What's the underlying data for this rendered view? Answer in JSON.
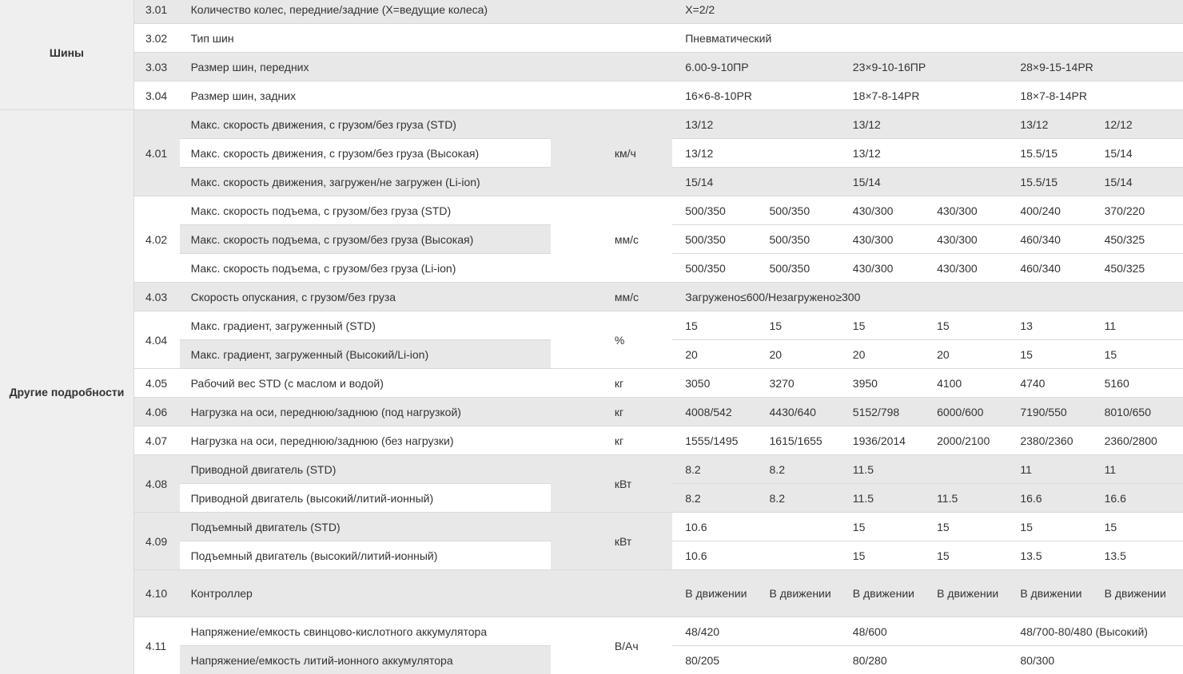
{
  "sections": [
    {
      "label": "Шины"
    },
    {
      "label": "Другие подробности"
    }
  ],
  "rows": [
    {
      "code": "3.01",
      "desc": "Количество колес, передние/задние (X=ведущие колеса)",
      "unit": "",
      "values": [
        "X=2/2"
      ]
    },
    {
      "code": "3.02",
      "desc": "Тип шин",
      "unit": "",
      "values": [
        "Пневматический"
      ]
    },
    {
      "code": "3.03",
      "desc": "Размер шин, передних",
      "unit": "",
      "values": [
        "6.00-9-10ПР",
        "23×9-10-16ПР",
        "28×9-15-14PR"
      ]
    },
    {
      "code": "3.04",
      "desc": "Размер шин, задних",
      "unit": "",
      "values": [
        "16×6-8-10PR",
        "18×7-8-14PR",
        "18×7-8-14PR"
      ]
    },
    {
      "code": "4.01",
      "desc": "Макс. скорость движения, с грузом/без груза (STD)",
      "unit": "км/ч",
      "values": [
        "13/12",
        "13/12",
        "13/12",
        "12/12"
      ]
    },
    {
      "code": "",
      "desc": "Макс. скорость движения, с грузом/без груза (Высокая)",
      "unit": "",
      "values": [
        "13/12",
        "13/12",
        "15.5/15",
        "15/14"
      ]
    },
    {
      "code": "",
      "desc": "Макс. скорость движения, загружен/не загружен (Li-ion)",
      "unit": "",
      "values": [
        "15/14",
        "15/14",
        "15.5/15",
        "15/14"
      ]
    },
    {
      "code": "4.02",
      "desc": "Макс. скорость подъема, с грузом/без груза (STD)",
      "unit": "мм/с",
      "values": [
        "500/350",
        "500/350",
        "430/300",
        "430/300",
        "400/240",
        "370/220"
      ]
    },
    {
      "code": "",
      "desc": "Макс. скорость подъема, с грузом/без груза (Высокая)",
      "unit": "",
      "values": [
        "500/350",
        "500/350",
        "430/300",
        "430/300",
        "460/340",
        "450/325"
      ]
    },
    {
      "code": "",
      "desc": "Макс. скорость подъема, с грузом/без груза (Li-ion)",
      "unit": "",
      "values": [
        "500/350",
        "500/350",
        "430/300",
        "430/300",
        "460/340",
        "450/325"
      ]
    },
    {
      "code": "4.03",
      "desc": "Скорость опускания, с грузом/без груза",
      "unit": "мм/с",
      "values": [
        "Загружено≤600/Незагружено≥300"
      ]
    },
    {
      "code": "4.04",
      "desc": "Макс. градиент, загруженный (STD)",
      "unit": "%",
      "values": [
        "15",
        "15",
        "15",
        "15",
        "13",
        "11"
      ]
    },
    {
      "code": "",
      "desc": "Макс. градиент, загруженный (Высокий/Li-ion)",
      "unit": "",
      "values": [
        "20",
        "20",
        "20",
        "20",
        "15",
        "15"
      ]
    },
    {
      "code": "4.05",
      "desc": "Рабочий вес STD (с маслом и водой)",
      "unit": "кг",
      "values": [
        "3050",
        "3270",
        "3950",
        "4100",
        "4740",
        "5160"
      ]
    },
    {
      "code": "4.06",
      "desc": "Нагрузка на оси, переднюю/заднюю (под нагрузкой)",
      "unit": "кг",
      "values": [
        "4008/542",
        "4430/640",
        "5152/798",
        "6000/600",
        "7190/550",
        "8010/650"
      ]
    },
    {
      "code": "4.07",
      "desc": "Нагрузка на оси, переднюю/заднюю (без нагрузки)",
      "unit": "кг",
      "values": [
        "1555/1495",
        "1615/1655",
        "1936/2014",
        "2000/2100",
        "2380/2360",
        "2360/2800"
      ]
    },
    {
      "code": "4.08",
      "desc": "Приводной двигатель (STD)",
      "unit": "кВт",
      "values": [
        "8.2",
        "8.2",
        "11.5",
        "",
        "11",
        "11"
      ]
    },
    {
      "code": "",
      "desc": "Приводной двигатель (высокий/литий-ионный)",
      "unit": "",
      "values": [
        "8.2",
        "8.2",
        "11.5",
        "11.5",
        "16.6",
        "16.6"
      ]
    },
    {
      "code": "4.09",
      "desc": "Подъемный двигатель (STD)",
      "unit": "кВт",
      "values": [
        "10.6",
        "",
        "15",
        "15",
        "15",
        "15"
      ]
    },
    {
      "code": "",
      "desc": "Подъемный двигатель (высокий/литий-ионный)",
      "unit": "",
      "values": [
        "10.6",
        "",
        "15",
        "15",
        "13.5",
        "13.5"
      ]
    },
    {
      "code": "4.10",
      "desc": "Контроллер",
      "unit": "",
      "values": [
        "В движении",
        "В движении",
        "В движении",
        "В движении",
        "В движении",
        "В движении"
      ]
    },
    {
      "code": "4.11",
      "desc": "Напряжение/емкость свинцово-кислотного аккумулятора",
      "unit": "В/Ач",
      "values": [
        "48/420",
        "48/600",
        "48/700-80/480 (Высокий)"
      ]
    },
    {
      "code": "",
      "desc": "Напряжение/емкость литий-ионного аккумулятора",
      "unit": "",
      "values": [
        "80/205",
        "80/280",
        "80/300"
      ]
    }
  ]
}
